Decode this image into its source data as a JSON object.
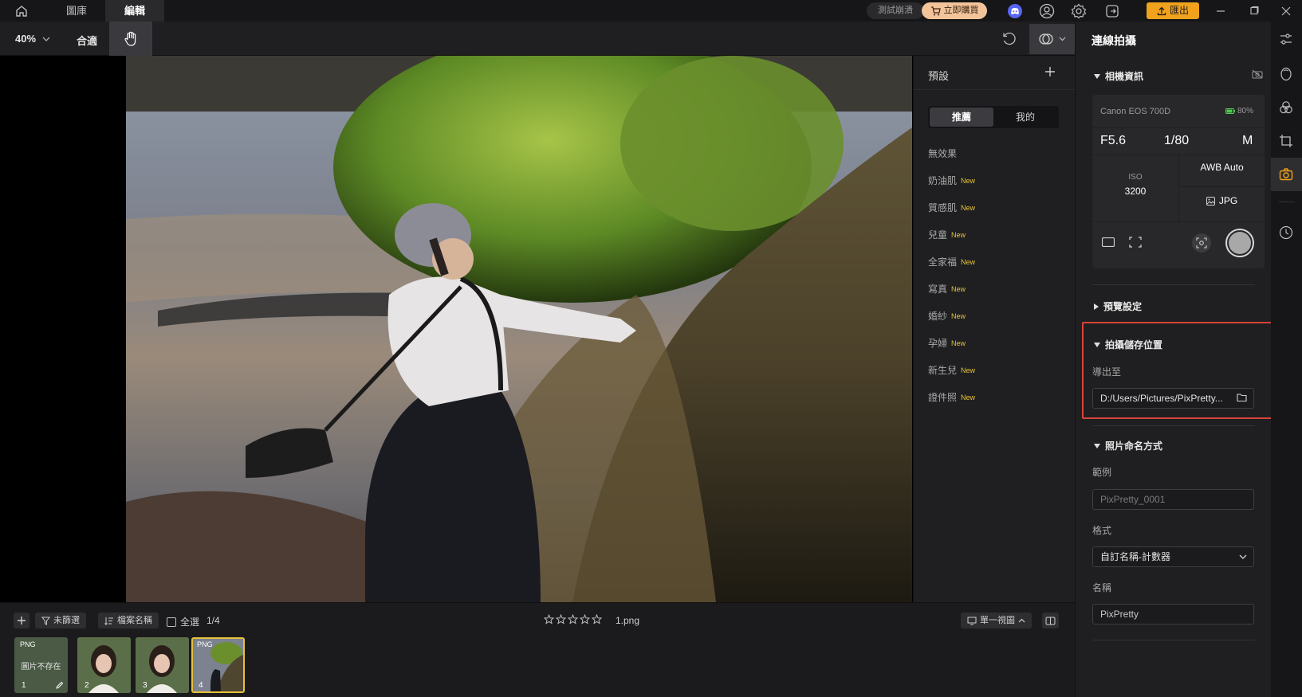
{
  "titlebar": {
    "tabs": [
      {
        "label": "圖庫"
      },
      {
        "label": "編輯"
      }
    ],
    "test_crash_label": "測試崩潰",
    "buy_label": "立即購買",
    "export_label": "匯出"
  },
  "toolbar": {
    "zoom": "40%",
    "fit_label": "合適"
  },
  "presets": {
    "title": "預設",
    "tab_recommended": "推薦",
    "tab_mine": "我的",
    "new_badge": "New",
    "items": [
      {
        "label": "無效果",
        "is_new": false
      },
      {
        "label": "奶油肌",
        "is_new": true
      },
      {
        "label": "質感肌",
        "is_new": true
      },
      {
        "label": "兒童",
        "is_new": true
      },
      {
        "label": "全家福",
        "is_new": true
      },
      {
        "label": "寫真",
        "is_new": true
      },
      {
        "label": "婚紗",
        "is_new": true
      },
      {
        "label": "孕婦",
        "is_new": true
      },
      {
        "label": "新生兒",
        "is_new": true
      },
      {
        "label": "證件照",
        "is_new": true
      }
    ]
  },
  "filmbar": {
    "unfiltered_label": "未篩選",
    "filename_label": "檔案名稱",
    "select_all_label": "全選",
    "count": "1/4",
    "rating": 0,
    "current_file": "1.png",
    "single_view_label": "單一視圖",
    "thumbs": [
      {
        "index": "1",
        "badge": "PNG",
        "missing_text": "圖片不存在"
      },
      {
        "index": "2",
        "badge": "",
        "missing_text": ""
      },
      {
        "index": "3",
        "badge": "",
        "missing_text": ""
      },
      {
        "index": "4",
        "badge": "PNG",
        "missing_text": ""
      }
    ]
  },
  "tethered": {
    "title": "連線拍攝",
    "camera_section": "相機資訊",
    "camera_model": "Canon EOS 700D",
    "battery": "80%",
    "aperture": "F5.6",
    "shutter": "1/80",
    "mode": "M",
    "iso_label": "ISO",
    "iso_value": "3200",
    "wb": "AWB Auto",
    "format": "JPG",
    "preview_section": "預覽設定",
    "storage_section": "拍攝儲存位置",
    "export_to_label": "導出至",
    "export_path": "D:/Users/Pictures/PixPretty...",
    "naming_section": "照片命名方式",
    "example_label": "範例",
    "example_placeholder": "PixPretty_0001",
    "format_label": "格式",
    "format_value": "自訂名稱-計數器",
    "name_label": "名稱",
    "name_value": "PixPretty"
  },
  "colors": {
    "accent_orange": "#f0a21c",
    "highlight_red": "#d9443a",
    "new_badge": "#e6c23a"
  }
}
